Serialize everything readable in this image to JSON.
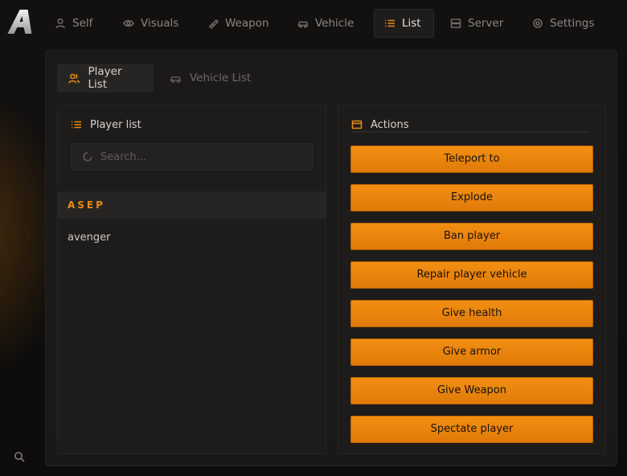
{
  "logo": {
    "letter": "A"
  },
  "nav": {
    "tabs": [
      {
        "label": "Self",
        "icon": "person-icon"
      },
      {
        "label": "Visuals",
        "icon": "eye-icon"
      },
      {
        "label": "Weapon",
        "icon": "gun-icon"
      },
      {
        "label": "Vehicle",
        "icon": "car-icon"
      },
      {
        "label": "List",
        "icon": "list-icon",
        "active": true
      },
      {
        "label": "Server",
        "icon": "server-icon"
      },
      {
        "label": "Settings",
        "icon": "gear-icon"
      }
    ]
  },
  "subtabs": [
    {
      "label": "Player List",
      "icon": "users-icon",
      "active": true
    },
    {
      "label": "Vehicle List",
      "icon": "car-icon"
    }
  ],
  "player_panel": {
    "title": "Player list",
    "search_placeholder": "Search...",
    "players": [
      {
        "name": "ASEP",
        "selected": true
      },
      {
        "name": "avenger",
        "selected": false
      }
    ]
  },
  "actions_panel": {
    "title": "Actions",
    "buttons": [
      "Teleport to",
      "Explode",
      "Ban player",
      "Repair player vehicle",
      "Give health",
      "Give armor",
      "Give Weapon",
      "Spectate player"
    ]
  },
  "colors": {
    "accent": "#e88b14",
    "background": "#0f0e0d",
    "panel": "#1d1c1b"
  }
}
